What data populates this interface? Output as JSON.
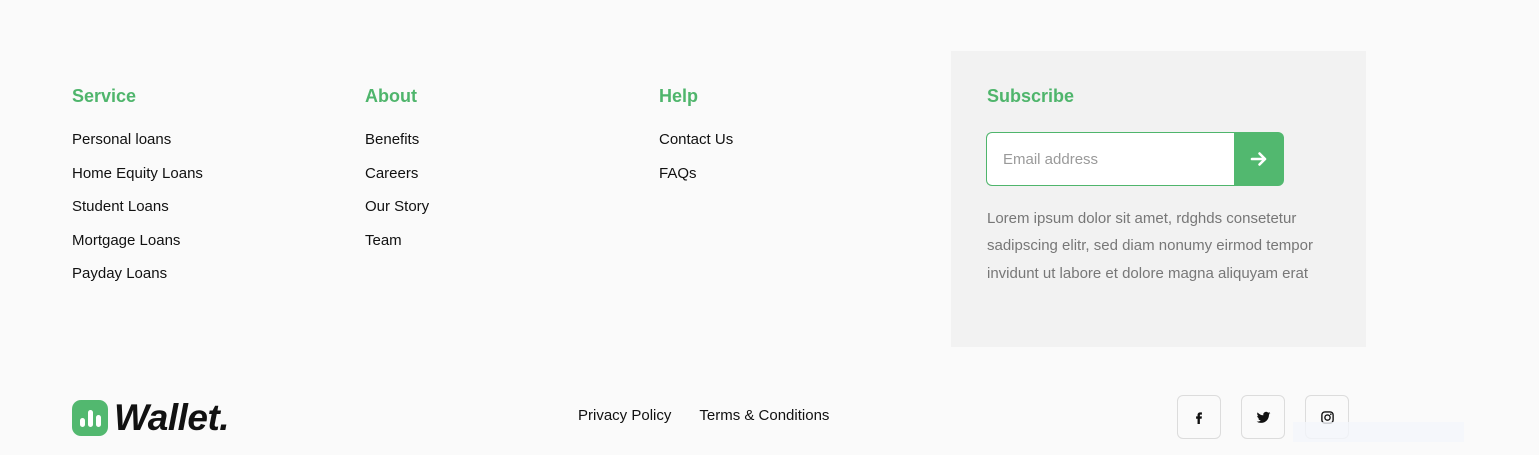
{
  "columns": {
    "service": {
      "title": "Service",
      "items": [
        "Personal loans",
        "Home Equity Loans",
        "Student Loans",
        "Mortgage Loans",
        "Payday Loans"
      ]
    },
    "about": {
      "title": "About",
      "items": [
        "Benefits",
        "Careers",
        "Our Story",
        "Team"
      ]
    },
    "help": {
      "title": "Help",
      "items": [
        "Contact Us",
        "FAQs"
      ]
    }
  },
  "subscribe": {
    "title": "Subscribe",
    "email_placeholder": "Email address",
    "email_value": "",
    "submit_icon": "arrow-right-icon",
    "description": "Lorem ipsum dolor sit amet, rdghds consetetur sadipscing elitr, sed diam nonumy eirmod tempor invidunt ut labore et dolore magna aliquyam erat"
  },
  "brand": {
    "name": "Wallet.",
    "logo_icon": "wallet-bars-icon",
    "accent_color": "#4fb56c"
  },
  "legal": {
    "privacy_label": "Privacy Policy",
    "terms_label": "Terms & Conditions"
  },
  "socials": [
    {
      "icon": "facebook-icon"
    },
    {
      "icon": "twitter-icon"
    },
    {
      "icon": "instagram-icon"
    }
  ]
}
